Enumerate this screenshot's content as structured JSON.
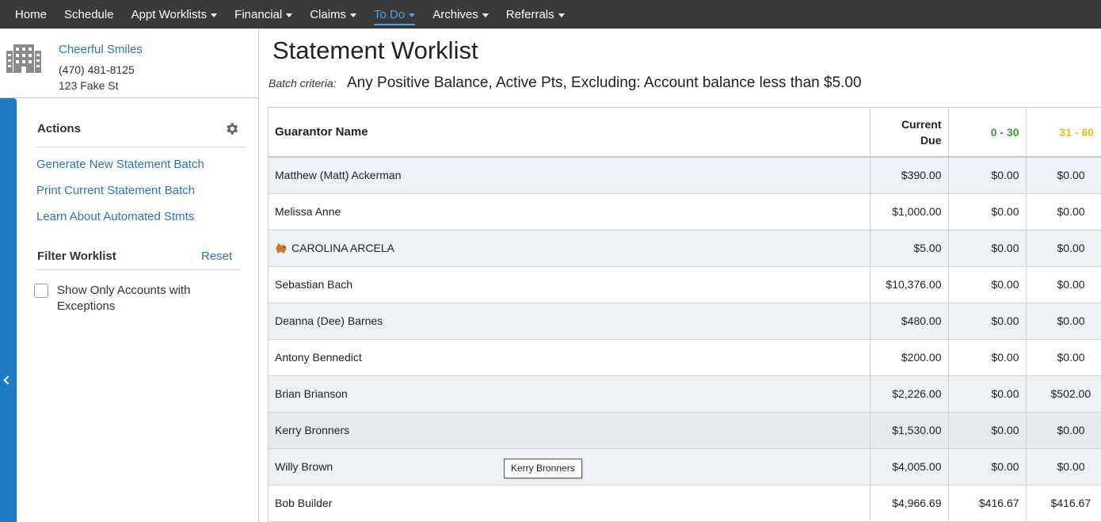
{
  "nav": {
    "items": [
      {
        "label": "Home",
        "dropdown": false,
        "active": false
      },
      {
        "label": "Schedule",
        "dropdown": false,
        "active": false
      },
      {
        "label": "Appt Worklists",
        "dropdown": true,
        "active": false
      },
      {
        "label": "Financial",
        "dropdown": true,
        "active": false
      },
      {
        "label": "Claims",
        "dropdown": true,
        "active": false
      },
      {
        "label": "To Do",
        "dropdown": true,
        "active": true
      },
      {
        "label": "Archives",
        "dropdown": true,
        "active": false
      },
      {
        "label": "Referrals",
        "dropdown": true,
        "active": false
      }
    ]
  },
  "practice": {
    "name": "Cheerful Smiles",
    "phone": "(470) 481-8125",
    "address": "123 Fake St",
    "icon": "building-icon"
  },
  "sidebar": {
    "actions_title": "Actions",
    "actions": [
      {
        "label": "Generate New Statement Batch"
      },
      {
        "label": "Print Current Statement Batch"
      },
      {
        "label": "Learn About Automated Stmts"
      }
    ],
    "filter_title": "Filter Worklist",
    "reset_label": "Reset",
    "checkbox_label": "Show Only Accounts with Exceptions",
    "checkbox_checked": false
  },
  "main": {
    "title": "Statement Worklist",
    "criteria_label": "Batch criteria:",
    "criteria_value": "Any Positive Balance, Active Pts, Excluding: Account balance less than $5.00"
  },
  "table": {
    "headers": {
      "name": "Guarantor Name",
      "current_line1": "Current",
      "current_line2": "Due",
      "aging1": "0 - 30",
      "aging2": "31 - 60"
    },
    "header_colors": {
      "aging1": "#3a9a3a",
      "aging2": "#e0c020"
    },
    "rows": [
      {
        "name": "Matthew (Matt) Ackerman",
        "current": "$390.00",
        "a1": "$0.00",
        "a2": "$0.00",
        "icon": ""
      },
      {
        "name": "Melissa Anne",
        "current": "$1,000.00",
        "a1": "$0.00",
        "a2": "$0.00",
        "icon": ""
      },
      {
        "name": "CAROLINA ARCELA",
        "current": "$5.00",
        "a1": "$0.00",
        "a2": "$0.00",
        "icon": "piggy-bank-icon"
      },
      {
        "name": "Sebastian Bach",
        "current": "$10,376.00",
        "a1": "$0.00",
        "a2": "$0.00",
        "icon": ""
      },
      {
        "name": "Deanna (Dee) Barnes",
        "current": "$480.00",
        "a1": "$0.00",
        "a2": "$0.00",
        "icon": ""
      },
      {
        "name": "Antony Bennedict",
        "current": "$200.00",
        "a1": "$0.00",
        "a2": "$0.00",
        "icon": ""
      },
      {
        "name": "Brian Brianson",
        "current": "$2,226.00",
        "a1": "$0.00",
        "a2": "$502.00",
        "icon": ""
      },
      {
        "name": "Kerry Bronners",
        "current": "$1,530.00",
        "a1": "$0.00",
        "a2": "$0.00",
        "icon": ""
      },
      {
        "name": "Willy Brown",
        "current": "$4,005.00",
        "a1": "$0.00",
        "a2": "$0.00",
        "icon": ""
      },
      {
        "name": "Bob Builder",
        "current": "$4,966.69",
        "a1": "$416.67",
        "a2": "$416.67",
        "icon": ""
      }
    ]
  },
  "tooltip": {
    "text": "Kerry Bronners"
  }
}
